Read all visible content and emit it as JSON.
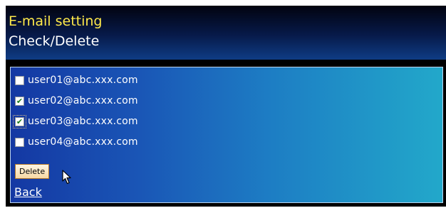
{
  "header": {
    "title": "E-mail setting",
    "subtitle": "Check/Delete"
  },
  "emails": [
    {
      "address": "user01@abc.xxx.com",
      "checked": false
    },
    {
      "address": "user02@abc.xxx.com",
      "checked": true
    },
    {
      "address": "user03@abc.xxx.com",
      "checked": true
    },
    {
      "address": "user04@abc.xxx.com",
      "checked": false
    }
  ],
  "actions": {
    "delete_label": "Delete",
    "back_label": "Back"
  },
  "colors": {
    "title": "#ffe94a",
    "text": "#ffffff",
    "check": "#1b7a1b",
    "button_bg": "#f7d9a4"
  },
  "icons": {
    "checkmark": "checkmark-icon",
    "cursor": "mouse-pointer-icon"
  }
}
